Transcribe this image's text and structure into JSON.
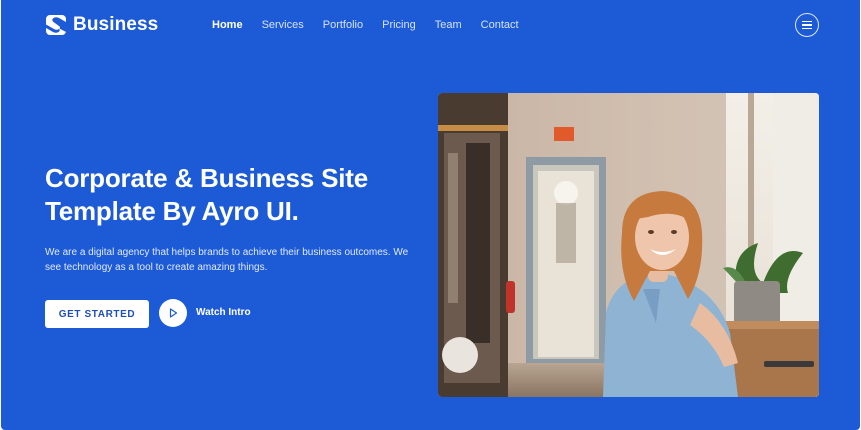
{
  "header": {
    "brand": "Business",
    "nav": [
      {
        "label": "Home",
        "active": true
      },
      {
        "label": "Services",
        "active": false
      },
      {
        "label": "Portfolio",
        "active": false
      },
      {
        "label": "Pricing",
        "active": false
      },
      {
        "label": "Team",
        "active": false
      },
      {
        "label": "Contact",
        "active": false
      }
    ]
  },
  "hero": {
    "title_line1": "Corporate & Business Site",
    "title_line2": "Template By Ayro UI.",
    "description_line1": "We are a digital agency that helps brands to achieve their business outcomes. We",
    "description_line2": "see technology as a tool to create amazing things.",
    "cta_label": "GET STARTED",
    "video_label": "Watch Intro"
  },
  "colors": {
    "background": "#1d5bd6",
    "accent_text": "#1d4fb8",
    "exit_sign": "#e05a2b"
  },
  "icons": {
    "logo": "logo-mark-icon",
    "menu": "hamburger-menu-icon",
    "play": "play-icon"
  }
}
